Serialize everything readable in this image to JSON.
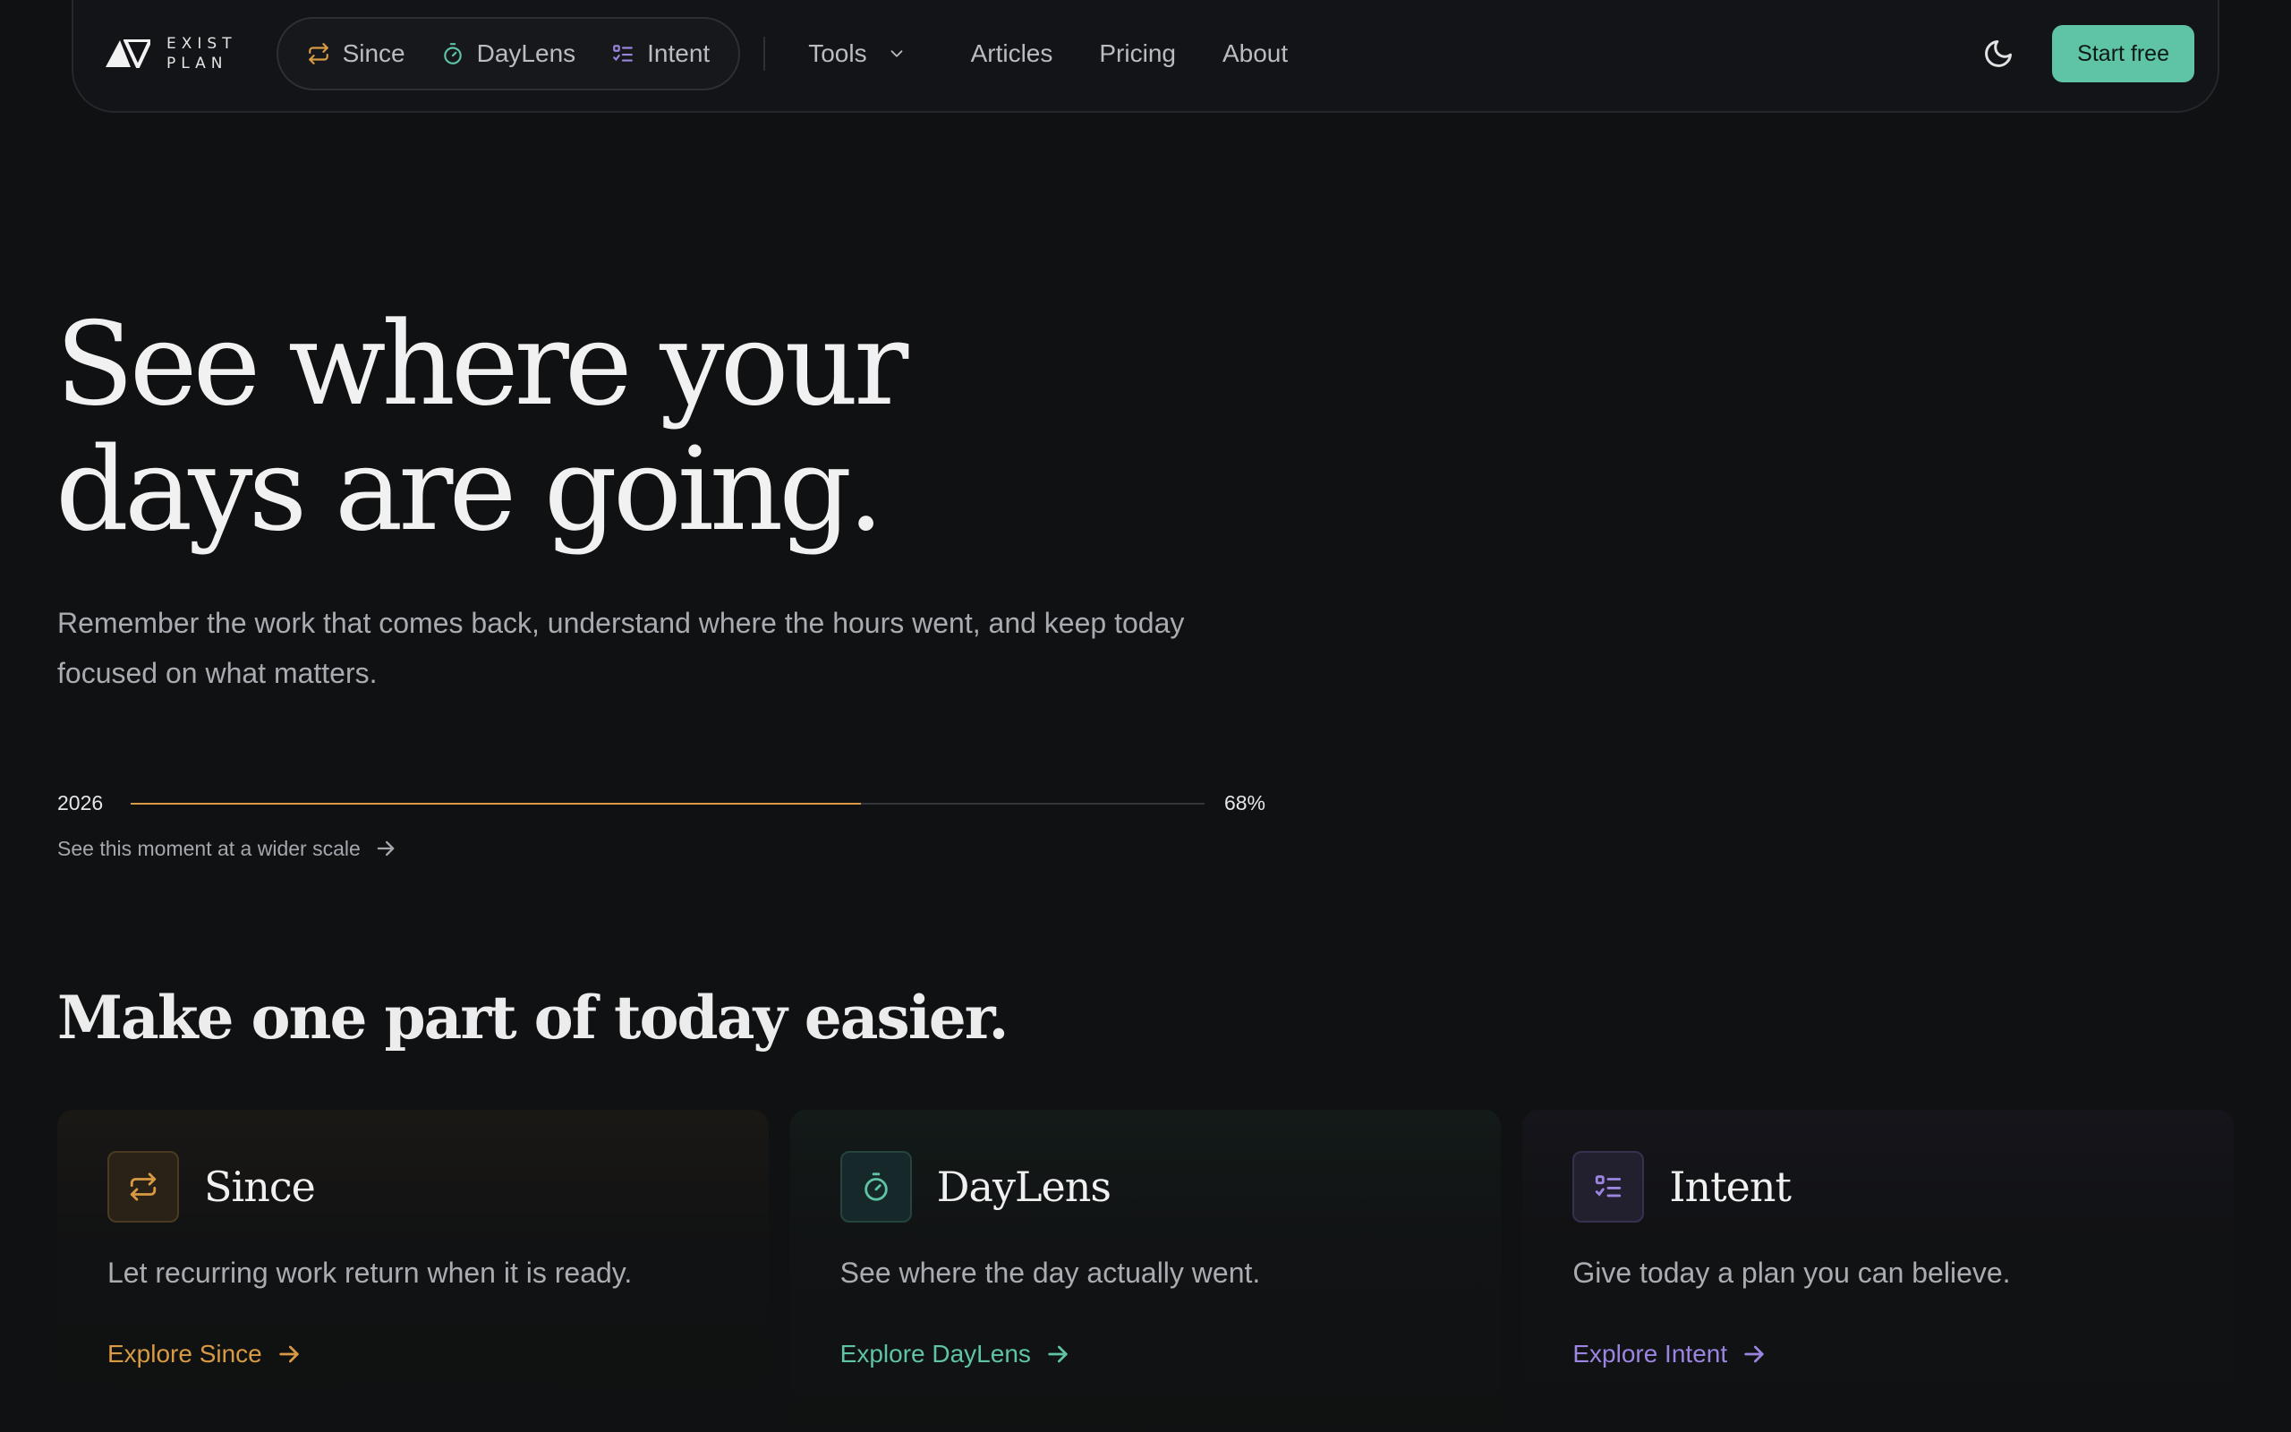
{
  "brand": {
    "line1": "EXIST",
    "line2": "PLAN"
  },
  "nav": {
    "pill": [
      {
        "label": "Since",
        "icon": "repeat-icon",
        "color": "#d99a44"
      },
      {
        "label": "DayLens",
        "icon": "stopwatch-icon",
        "color": "#5fc4a5"
      },
      {
        "label": "Intent",
        "icon": "checklist-icon",
        "color": "#9b85e0"
      }
    ],
    "tools": "Tools",
    "articles": "Articles",
    "pricing": "Pricing",
    "about": "About",
    "theme_icon": "moon-icon",
    "cta": "Start free"
  },
  "hero": {
    "title_line1": "See where your",
    "title_line2": "days are going.",
    "subtitle": "Remember the work that comes back, understand where the hours went, and keep today focused on what matters.",
    "progress": {
      "year": "2026",
      "percent_label": "68%",
      "value": 0.68
    },
    "wider_link": "See this moment at a wider scale"
  },
  "section": {
    "title": "Make one part of today easier."
  },
  "cards": [
    {
      "title": "Since",
      "description": "Let recurring work return when it is ready.",
      "link": "Explore Since",
      "icon": "repeat-icon",
      "accent": "#d99a44"
    },
    {
      "title": "DayLens",
      "description": "See where the day actually went.",
      "link": "Explore DayLens",
      "icon": "stopwatch-icon",
      "accent": "#5fc4a5"
    },
    {
      "title": "Intent",
      "description": "Give today a plan you can believe.",
      "link": "Explore Intent",
      "icon": "checklist-icon",
      "accent": "#9b85e0"
    }
  ],
  "colors": {
    "background": "#0f1113",
    "cta": "#5fc4a5",
    "progress": "#d99a44"
  }
}
